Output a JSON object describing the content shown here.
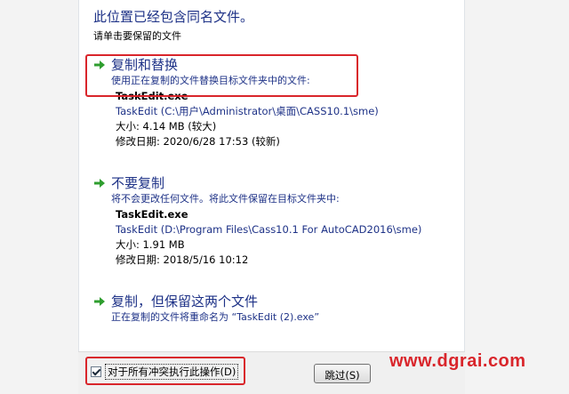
{
  "dialog": {
    "title": "此位置已经包含同名文件。",
    "subtitle": "请单击要保留的文件"
  },
  "options": [
    {
      "title": "复制和替换",
      "description": "使用正在复制的文件替换目标文件夹中的文件:",
      "file": {
        "name": "TaskEdit.exe",
        "path": "TaskEdit (C:\\用户\\Administrator\\桌面\\CASS10.1\\sme)",
        "size": "大小: 4.14 MB (较大)",
        "modified": "修改日期: 2020/6/28 17:53 (较新)"
      }
    },
    {
      "title": "不要复制",
      "description": "将不会更改任何文件。将此文件保留在目标文件夹中:",
      "file": {
        "name": "TaskEdit.exe",
        "path": "TaskEdit (D:\\Program Files\\Cass10.1 For AutoCAD2016\\sme)",
        "size": "大小: 1.91 MB",
        "modified": "修改日期: 2018/5/16 10:12"
      }
    },
    {
      "title": "复制，但保留这两个文件",
      "description": "正在复制的文件将重命名为 “TaskEdit (2).exe”"
    }
  ],
  "footer": {
    "apply_all_label": "对于所有冲突执行此操作(D)",
    "apply_all_checked": true,
    "skip_label": "跳过(S)"
  },
  "watermark": "www.dgrai.com",
  "colors": {
    "title_blue": "#1e3287",
    "highlight_red": "#d9252b",
    "arrow_green": "#2f9e2f"
  }
}
